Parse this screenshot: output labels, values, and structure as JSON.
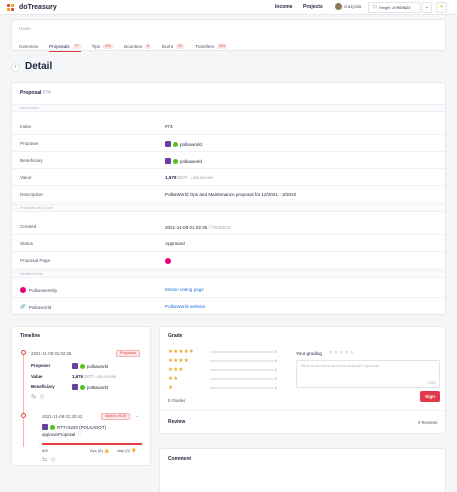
{
  "topbar": {
    "app_name": "doTreasury",
    "nav": [
      "Income",
      "Projects"
    ],
    "user": "crazyola",
    "height_label": "Height",
    "height_value": "#7909623",
    "chevron": "⌄",
    "theme_icon": "☀"
  },
  "breadcrumb": "Home",
  "tabs": [
    {
      "label": "Overview",
      "count": null
    },
    {
      "label": "Proposals",
      "count": "77"
    },
    {
      "label": "Tips",
      "count": "331"
    },
    {
      "label": "Bounties",
      "count": "8"
    },
    {
      "label": "Burnt",
      "count": "22"
    },
    {
      "label": "Transfers",
      "count": "331"
    }
  ],
  "page_title": "Detail",
  "back_icon": "‹",
  "detail": {
    "header": "Proposal",
    "header_id": "#74",
    "sections": {
      "information": "Information",
      "lifecycle": "Proposal Life Cycle",
      "related": "Related Links"
    },
    "rows": {
      "index": {
        "k": "Index",
        "v": "#74"
      },
      "proposer": {
        "k": "Proposer",
        "v": "polkaworld"
      },
      "beneficiary": {
        "k": "Beneficiary",
        "v": "polkaworld"
      },
      "value": {
        "k": "Value",
        "amount": "1,676",
        "unit": "DOT",
        "usd": "≈ $90,909.896"
      },
      "description": {
        "k": "Description",
        "v": "PolkaWorld Ops and Maintenance proposal for 12/2021 - 3/2022"
      },
      "created": {
        "k": "Created",
        "v": "2021-11-08 01:02:36",
        "block": "7610572"
      },
      "status": {
        "k": "Status",
        "v": "Approved"
      },
      "proposal_page": {
        "k": "Proposal Page"
      }
    },
    "links": [
      {
        "k": "Polkassembly",
        "v": "Motion voting page"
      },
      {
        "k": "Polkaworld",
        "v": "PolkaWorld website"
      }
    ]
  },
  "timeline": {
    "title": "Timeline",
    "item1": {
      "date": "2021-11-08 01:02:36",
      "badge": "Proposed",
      "proposer_k": "Proposer",
      "proposer_v": "polkaworld",
      "value_k": "Value",
      "value_amount": "1,676",
      "value_unit": "DOT",
      "value_usd": "≈ $90,909.896",
      "beneficiary_k": "Beneficiary",
      "beneficiary_v": "polkaworld"
    },
    "item2": {
      "date": "2021-11-08 01:33:42",
      "badge": "Motion #135",
      "signer": "RTTI-5220 (POLKADOT)",
      "action": "approveProposal",
      "progress": "8/8",
      "aye": "Aye (8)",
      "nay": "Nay (0)"
    },
    "small_icons": "⇆ ◇"
  },
  "grade": {
    "title": "Grade",
    "rows": [
      {
        "stars": "★★★★★",
        "count": "0"
      },
      {
        "stars": "★★★★",
        "count": "0"
      },
      {
        "stars": "★★★",
        "count": "0"
      },
      {
        "stars": "★★",
        "count": "0"
      },
      {
        "stars": "★",
        "count": "0"
      }
    ],
    "total": "0 Grades",
    "your_grading": "Your grading",
    "empty_stars": "★★★★★",
    "placeholder": "What do you think about this proposal? (optional)",
    "char_count": "0/280",
    "sign": "Sign",
    "review_title": "Review",
    "review_count": "0 Reviews"
  },
  "comment": {
    "title": "Comment"
  },
  "colors": {
    "accent": "#e53e3e",
    "link": "#1f6fd6",
    "star": "#f0a020"
  }
}
